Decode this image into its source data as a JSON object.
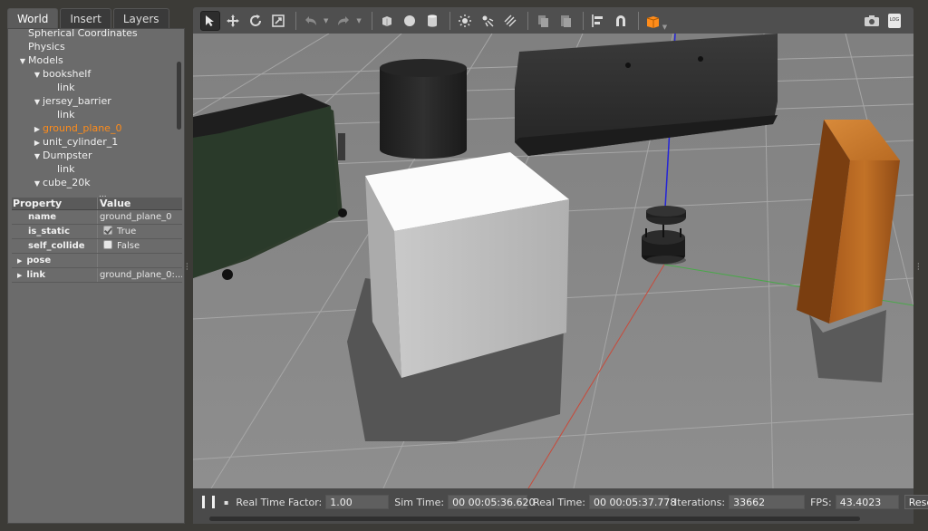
{
  "left_panel": {
    "tabs": [
      "World",
      "Insert",
      "Layers"
    ],
    "tree": [
      {
        "label": "Spherical Coordinates",
        "level": 0,
        "arrow": ""
      },
      {
        "label": "Physics",
        "level": 0,
        "arrow": ""
      },
      {
        "label": "Models",
        "level": 0,
        "arrow": "down"
      },
      {
        "label": "bookshelf",
        "level": 1,
        "arrow": "down"
      },
      {
        "label": "link",
        "level": 2,
        "arrow": ""
      },
      {
        "label": "jersey_barrier",
        "level": 1,
        "arrow": "down"
      },
      {
        "label": "link",
        "level": 2,
        "arrow": ""
      },
      {
        "label": "ground_plane_0",
        "level": 1,
        "arrow": "right",
        "selected": true
      },
      {
        "label": "unit_cylinder_1",
        "level": 1,
        "arrow": "right"
      },
      {
        "label": "Dumpster",
        "level": 1,
        "arrow": "down"
      },
      {
        "label": "link",
        "level": 2,
        "arrow": ""
      },
      {
        "label": "cube_20k",
        "level": 1,
        "arrow": "down"
      }
    ],
    "tree_more": "...",
    "properties": {
      "header_property": "Property",
      "header_value": "Value",
      "name_label": "name",
      "name_value": "ground_plane_0",
      "is_static_label": "is_static",
      "is_static_value": "True",
      "self_collide_label": "self_collide",
      "self_collide_value": "False",
      "pose_label": "pose",
      "link_label": "link",
      "link_value": "ground_plane_0:..."
    }
  },
  "toolbar": {
    "icons": [
      "select-mode-icon",
      "translate-mode-icon",
      "rotate-mode-icon",
      "scale-mode-icon",
      "undo-icon",
      "redo-icon",
      "box-shape-icon",
      "sphere-shape-icon",
      "cylinder-shape-icon",
      "point-light-icon",
      "spot-light-icon",
      "directional-light-icon",
      "copy-icon",
      "paste-icon",
      "align-icon",
      "magnet-snap-icon",
      "view-angle-icon",
      "screenshot-icon",
      "log-icon"
    ],
    "log_text": "LOG"
  },
  "bottom_bar": {
    "rtf_label": "Real Time Factor:",
    "rtf_value": "1.00",
    "sim_time_label": "Sim Time:",
    "sim_time_value": "00 00:05:36.620",
    "real_time_label": "Real Time:",
    "real_time_value": "00 00:05:37.778",
    "iterations_label": "Iterations:",
    "iterations_value": "33662",
    "fps_label": "FPS:",
    "fps_value": "43.4023",
    "reset_label": "Rese"
  },
  "colors": {
    "selection_orange": "#ff8c1a",
    "ground_gray": "#8c8c8c",
    "panel_gray": "#6b6b6b"
  }
}
